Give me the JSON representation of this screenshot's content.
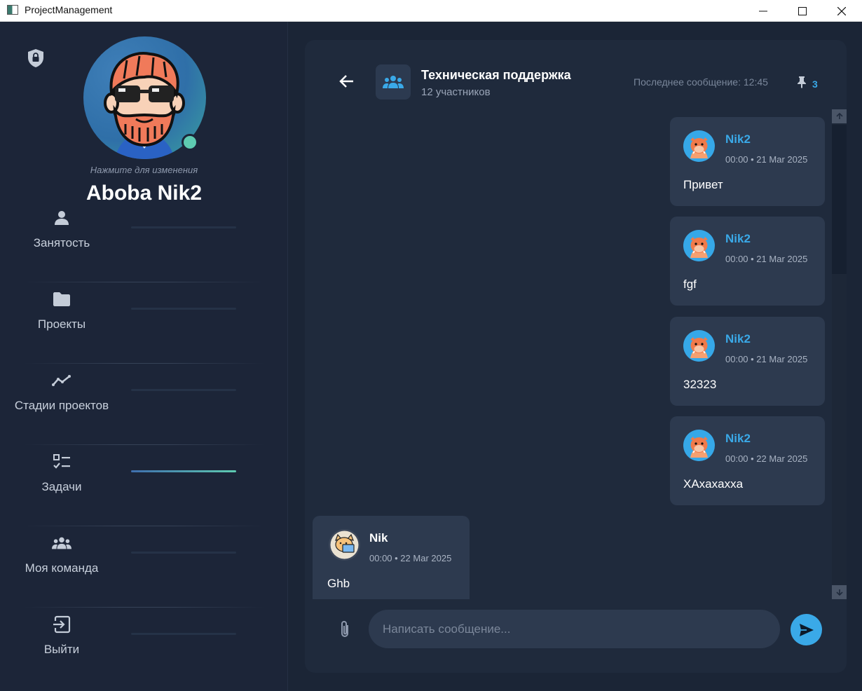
{
  "window": {
    "title": "ProjectManagement"
  },
  "profile": {
    "change_hint": "Нажмите для изменения",
    "name": "Aboba Nik2",
    "status_color": "#5ecbb1"
  },
  "nav": {
    "items": [
      {
        "label": "Занятость",
        "icon": "person-icon",
        "active": false
      },
      {
        "label": "Проекты",
        "icon": "folder-icon",
        "active": false
      },
      {
        "label": "Стадии проектов",
        "icon": "trend-icon",
        "active": false
      },
      {
        "label": "Задачи",
        "icon": "checklist-icon",
        "active": true
      },
      {
        "label": "Моя команда",
        "icon": "team-icon",
        "active": false
      },
      {
        "label": "Выйти",
        "icon": "logout-icon",
        "active": false
      }
    ]
  },
  "chat": {
    "title": "Техническая поддержка",
    "subtitle": "12 участников",
    "last_message": "Последнее сообщение: 12:45",
    "pinned_count": "3",
    "messages": [
      {
        "author": "Nik2",
        "time": "00:00 • 21 Mar 2025",
        "text": "Привет",
        "own": true
      },
      {
        "author": "Nik2",
        "time": "00:00 • 21 Mar 2025",
        "text": "fgf",
        "own": true
      },
      {
        "author": "Nik2",
        "time": "00:00 • 21 Mar 2025",
        "text": "32323",
        "own": true
      },
      {
        "author": "Nik2",
        "time": "00:00 • 22 Mar 2025",
        "text": "XAxaxaxxa",
        "own": true
      },
      {
        "author": "Nik",
        "time": "00:00 • 22 Mar 2025",
        "text": "Ghb",
        "own": false
      }
    ],
    "composer_placeholder": "Написать сообщение..."
  },
  "colors": {
    "accent": "#3aa9e8",
    "active_bar_start": "#3f6fae",
    "active_bar_end": "#5ecbb1"
  }
}
